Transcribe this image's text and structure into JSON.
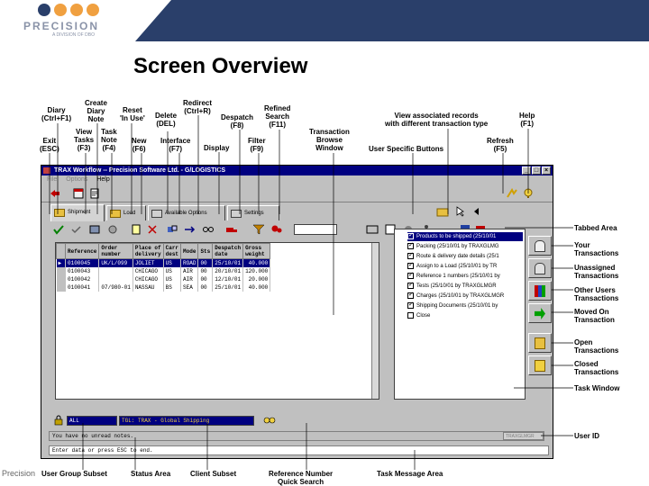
{
  "header": {
    "logo_word": "PRECISION",
    "logo_sub": "A DIVISION OF DBO",
    "logo_dot_colors": [
      "#2a3f6a",
      "#f0a040",
      "#f0a040",
      "#f0a040"
    ],
    "band_color": "#2a3f6a"
  },
  "title": "Screen Overview",
  "footer_text": "Precision",
  "callouts": {
    "diary": "Diary\n(Ctrl+F1)",
    "create_diary_note": "Create\nDiary\nNote",
    "reset_in_use": "Reset\n'In Use'",
    "delete": "Delete\n(DEL)",
    "redirect": "Redirect\n(Ctrl+R)",
    "despatch": "Despatch\n(F8)",
    "refined_search": "Refined\nSearch\n(F11)",
    "view_associated": "View associated records\nwith different transaction type",
    "help": "Help\n(F1)",
    "exit": "Exit\n(ESC)",
    "view_tasks": "View\nTasks\n(F3)",
    "task_note": "Task\nNote\n(F4)",
    "new": "New\n(F6)",
    "interface": "Interface\n(F7)",
    "display": "Display",
    "filter": "Filter\n(F9)",
    "transaction_browse": "Transaction\nBrowse\nWindow",
    "user_specific": "User Specific Buttons",
    "refresh": "Refresh\n(F5)",
    "tabbed_area": "Tabbed Area",
    "your_transactions": "Your\nTransactions",
    "unassigned": "Unassigned\nTransactions",
    "other_users": "Other Users\nTransactions",
    "moved_on": "Moved On\nTransaction",
    "open_transactions": "Open\nTransactions",
    "closed_transactions": "Closed\nTransactions",
    "task_window": "Task Window",
    "user_id": "User ID",
    "user_group_subset": "User Group Subset",
    "status_area": "Status Area",
    "client_subset": "Client Subset",
    "reference_number": "Reference Number\nQuick Search",
    "task_message_area": "Task Message Area"
  },
  "window": {
    "title": "TRAX Workflow -- Precision Software Ltd. - G/LOGISTICS",
    "menu": [
      "File",
      "Options",
      "Help"
    ],
    "window_buttons": [
      "_",
      "□",
      "×"
    ],
    "tabs": [
      "Shipment",
      "Load",
      "Available Options",
      "Settings"
    ],
    "columns": [
      "Reference",
      "Order\nnumber",
      "Place of\ndelivery",
      "Carr\ndest",
      "Mode",
      "Sts",
      "Despatch\ndate",
      "Gross\nweight"
    ],
    "rows": [
      [
        "0100045",
        "UK/L/099",
        "JOLIET",
        "US",
        "ROAD",
        "00",
        "25/10/01",
        "40.000"
      ],
      [
        "0100043",
        "",
        "CHICAGO",
        "US",
        "AIR",
        "00",
        "20/10/01",
        "120.000"
      ],
      [
        "0100042",
        "",
        "CHICAGO",
        "US",
        "AIR",
        "00",
        "12/10/01",
        "20.000"
      ],
      [
        "0100041",
        "07/980-01",
        "NASSAU",
        "BS",
        "SEA",
        "00",
        "25/10/01",
        "40.000"
      ]
    ],
    "tasks": [
      {
        "text": "Products to be shipped (25/10/01",
        "checked": true,
        "highlight": true
      },
      {
        "text": "Packing (25/10/01 by TRAXGLMG",
        "checked": true,
        "highlight": false
      },
      {
        "text": "Route & delivery date details (25/1",
        "checked": true,
        "highlight": false
      },
      {
        "text": "Assign to a Load (25/10/01 by TR",
        "checked": true,
        "highlight": false
      },
      {
        "text": "Reference 1 numbers (25/10/01 by",
        "checked": true,
        "highlight": false
      },
      {
        "text": "Tests (25/10/01 by TRAXGLMGR",
        "checked": true,
        "highlight": false
      },
      {
        "text": "Charges (25/10/01 by TRAXGLMGR",
        "checked": true,
        "highlight": false
      },
      {
        "text": "Shipping Documents (25/10/01 by",
        "checked": true,
        "highlight": false
      },
      {
        "text": "Close",
        "checked": false,
        "highlight": false
      }
    ],
    "user_group_value": "ALL",
    "client_subset_value": "TGL: TRAX - Global Shipping",
    "status_message": "You have no unread notes.",
    "task_message": "Enter data or press ESC to end.",
    "user_id_value": "TRAXGLMGR"
  }
}
